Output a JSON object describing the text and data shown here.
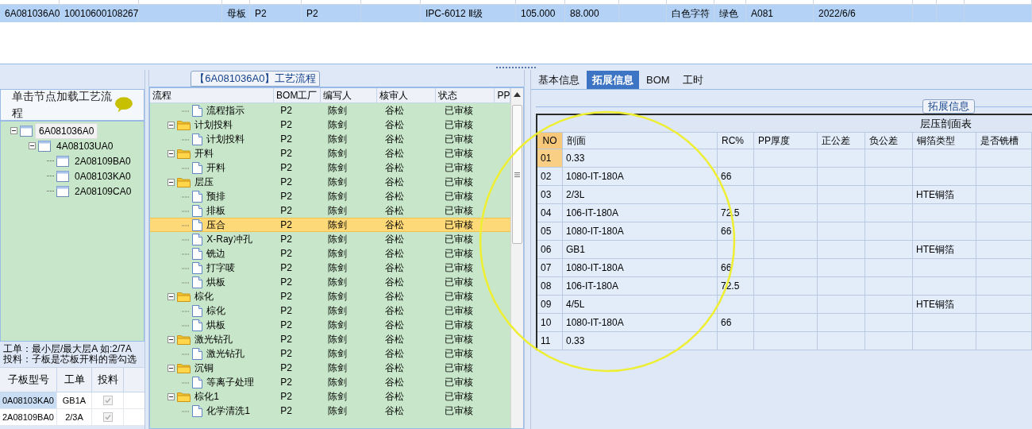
{
  "top_grid": {
    "rows": [
      {
        "selected": true,
        "cells": [
          "6A081036A0",
          "10010600108267",
          null,
          "母板",
          "P2",
          "P2",
          null,
          "IPC-6012 Ⅱ级",
          "105.000",
          "88.000",
          null,
          "白色字符",
          "绿色",
          "A081",
          "2022/6/6",
          null,
          null,
          null
        ]
      }
    ]
  },
  "left_panel": {
    "header": "单击节点加载工艺流程",
    "tree": [
      {
        "label": "6A081036A0",
        "selected": true,
        "expanded": true,
        "children": [
          {
            "label": "4A08103UA0",
            "selected": false,
            "expanded": true,
            "children": [
              {
                "label": "2A08109BA0",
                "selected": false
              },
              {
                "label": "0A08103KA0",
                "selected": false
              },
              {
                "label": "2A08109CA0",
                "selected": false
              }
            ]
          }
        ]
      }
    ],
    "notes": [
      "工单：最小层/最大层A 如:2/7A",
      "投料：子板是芯板开料的需勾选"
    ],
    "table": {
      "columns": [
        "子板型号",
        "工单",
        "投料"
      ],
      "rows": [
        {
          "board": "0A08103KA0",
          "order": "GB1A",
          "feed": true,
          "selected": true
        },
        {
          "board": "2A08109BA0",
          "order": "2/3A",
          "feed": true,
          "selected": false
        }
      ]
    }
  },
  "flow_panel": {
    "title": "【6A081036A0】工艺流程",
    "columns": [
      "流程",
      "BOM工厂",
      "编写人",
      "核审人",
      "状态",
      "PP"
    ],
    "rows": [
      {
        "kind": "step",
        "label": "流程指示",
        "factory": "P2",
        "author": "陈剑",
        "reviewer": "谷松",
        "status": "已审核",
        "selected": false
      },
      {
        "kind": "group",
        "label": "计划投料",
        "factory": "P2",
        "author": "陈剑",
        "reviewer": "谷松",
        "status": "已审核",
        "selected": false,
        "expanded": true,
        "children": [
          {
            "kind": "step",
            "label": "计划投料",
            "factory": "P2",
            "author": "陈剑",
            "reviewer": "谷松",
            "status": "已审核",
            "selected": false
          }
        ]
      },
      {
        "kind": "group",
        "label": "开料",
        "factory": "P2",
        "author": "陈剑",
        "reviewer": "谷松",
        "status": "已审核",
        "selected": false,
        "expanded": true,
        "children": [
          {
            "kind": "step",
            "label": "开料",
            "factory": "P2",
            "author": "陈剑",
            "reviewer": "谷松",
            "status": "已审核",
            "selected": false
          }
        ]
      },
      {
        "kind": "group",
        "label": "层压",
        "factory": "P2",
        "author": "陈剑",
        "reviewer": "谷松",
        "status": "已审核",
        "selected": false,
        "expanded": true,
        "children": [
          {
            "kind": "step",
            "label": "预排",
            "factory": "P2",
            "author": "陈剑",
            "reviewer": "谷松",
            "status": "已审核",
            "selected": false
          },
          {
            "kind": "step",
            "label": "排板",
            "factory": "P2",
            "author": "陈剑",
            "reviewer": "谷松",
            "status": "已审核",
            "selected": false
          },
          {
            "kind": "step",
            "label": "压合",
            "factory": "P2",
            "author": "陈剑",
            "reviewer": "谷松",
            "status": "已审核",
            "selected": true
          },
          {
            "kind": "step",
            "label": "X-Ray冲孔",
            "factory": "P2",
            "author": "陈剑",
            "reviewer": "谷松",
            "status": "已审核",
            "selected": false
          },
          {
            "kind": "step",
            "label": "铣边",
            "factory": "P2",
            "author": "陈剑",
            "reviewer": "谷松",
            "status": "已审核",
            "selected": false
          },
          {
            "kind": "step",
            "label": "打字唛",
            "factory": "P2",
            "author": "陈剑",
            "reviewer": "谷松",
            "status": "已审核",
            "selected": false
          },
          {
            "kind": "step",
            "label": "烘板",
            "factory": "P2",
            "author": "陈剑",
            "reviewer": "谷松",
            "status": "已审核",
            "selected": false
          }
        ]
      },
      {
        "kind": "group",
        "label": "棕化",
        "factory": "P2",
        "author": "陈剑",
        "reviewer": "谷松",
        "status": "已审核",
        "selected": false,
        "expanded": true,
        "children": [
          {
            "kind": "step",
            "label": "棕化",
            "factory": "P2",
            "author": "陈剑",
            "reviewer": "谷松",
            "status": "已审核",
            "selected": false
          },
          {
            "kind": "step",
            "label": "烘板",
            "factory": "P2",
            "author": "陈剑",
            "reviewer": "谷松",
            "status": "已审核",
            "selected": false
          }
        ]
      },
      {
        "kind": "group",
        "label": "激光钻孔",
        "factory": "P2",
        "author": "陈剑",
        "reviewer": "谷松",
        "status": "已审核",
        "selected": false,
        "expanded": true,
        "children": [
          {
            "kind": "step",
            "label": "激光钻孔",
            "factory": "P2",
            "author": "陈剑",
            "reviewer": "谷松",
            "status": "已审核",
            "selected": false
          }
        ]
      },
      {
        "kind": "group",
        "label": "沉铜",
        "factory": "P2",
        "author": "陈剑",
        "reviewer": "谷松",
        "status": "已审核",
        "selected": false,
        "expanded": true,
        "children": [
          {
            "kind": "step",
            "label": "等离子处理",
            "factory": "P2",
            "author": "陈剑",
            "reviewer": "谷松",
            "status": "已审核",
            "selected": false
          }
        ]
      },
      {
        "kind": "group",
        "label": "棕化1",
        "factory": "P2",
        "author": "陈剑",
        "reviewer": "谷松",
        "status": "已审核",
        "selected": false,
        "expanded": true,
        "children": [
          {
            "kind": "step",
            "label": "化学清洗1",
            "factory": "P2",
            "author": "陈剑",
            "reviewer": "谷松",
            "status": "已审核",
            "selected": false
          }
        ]
      }
    ]
  },
  "detail_panel": {
    "tabs": [
      {
        "label": "基本信息",
        "selected": false
      },
      {
        "label": "拓展信息",
        "selected": true
      },
      {
        "label": "BOM",
        "selected": false
      },
      {
        "label": "工时",
        "selected": false
      }
    ],
    "group_title": "拓展信息",
    "table": {
      "title": "层压剖面表",
      "columns": [
        "NO",
        "剖面",
        "RC%",
        "PP厚度",
        "正公差",
        "负公差",
        "铜箔类型",
        "是否铣槽"
      ],
      "rows": [
        {
          "cells": [
            "01",
            "0.33",
            null,
            null,
            null,
            null,
            null,
            null
          ],
          "selected": true
        },
        {
          "cells": [
            "02",
            "1080-IT-180A",
            "66",
            null,
            null,
            null,
            null,
            null
          ],
          "selected": false
        },
        {
          "cells": [
            "03",
            "2/3L",
            null,
            null,
            null,
            null,
            "HTE铜箔",
            null
          ],
          "selected": false
        },
        {
          "cells": [
            "04",
            "106-IT-180A",
            "72.5",
            null,
            null,
            null,
            null,
            null
          ],
          "selected": false
        },
        {
          "cells": [
            "05",
            "1080-IT-180A",
            "66",
            null,
            null,
            null,
            null,
            null
          ],
          "selected": false
        },
        {
          "cells": [
            "06",
            "GB1",
            null,
            null,
            null,
            null,
            "HTE铜箔",
            null
          ],
          "selected": false
        },
        {
          "cells": [
            "07",
            "1080-IT-180A",
            "66",
            null,
            null,
            null,
            null,
            null
          ],
          "selected": false
        },
        {
          "cells": [
            "08",
            "106-IT-180A",
            "72.5",
            null,
            null,
            null,
            null,
            null
          ],
          "selected": false
        },
        {
          "cells": [
            "09",
            "4/5L",
            null,
            null,
            null,
            null,
            "HTE铜箔",
            null
          ],
          "selected": false
        },
        {
          "cells": [
            "10",
            "1080-IT-180A",
            "66",
            null,
            null,
            null,
            null,
            null
          ],
          "selected": false
        },
        {
          "cells": [
            "11",
            "0.33",
            null,
            null,
            null,
            null,
            null,
            null
          ],
          "selected": false
        }
      ]
    }
  }
}
